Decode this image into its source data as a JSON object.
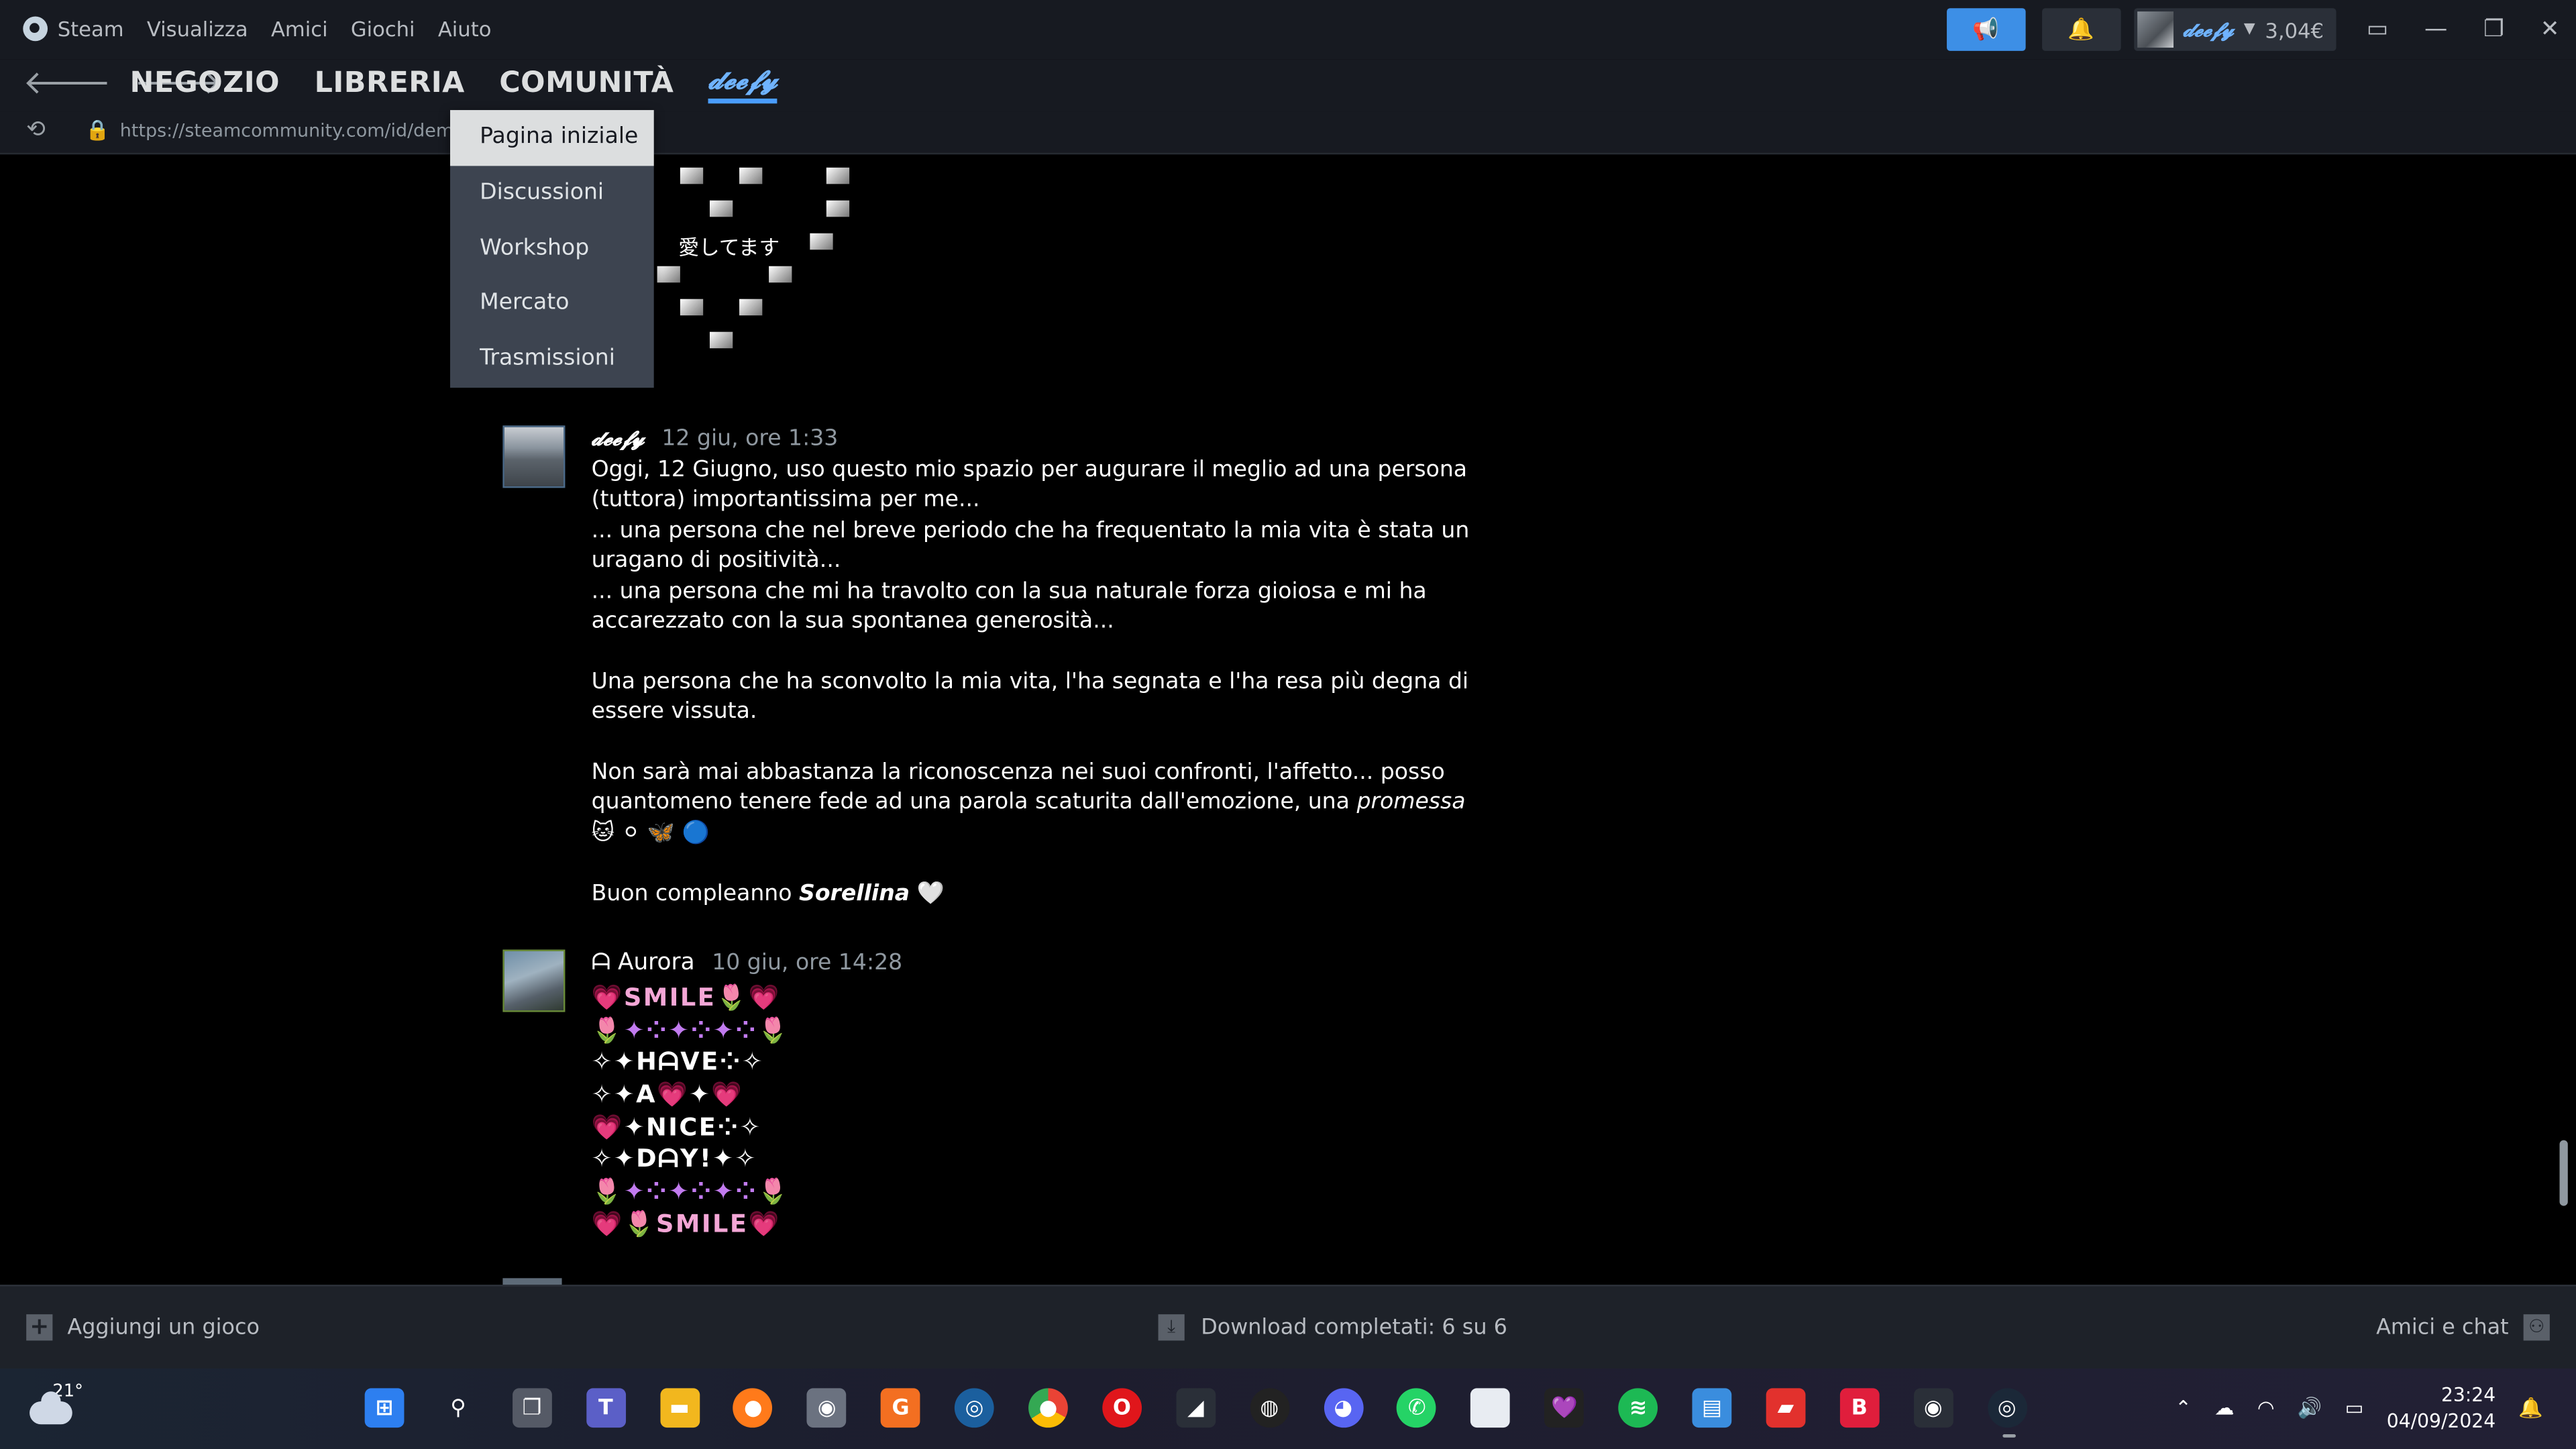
{
  "menubar": {
    "items": [
      "Steam",
      "Visualizza",
      "Amici",
      "Giochi",
      "Aiuto"
    ]
  },
  "account": {
    "nickname": "𝓭𝓮𝓮𝓯𝔂",
    "wallet": "3,04€"
  },
  "nav": {
    "links": [
      "NEGOZIO",
      "LIBRERIA",
      "COMUNITÀ"
    ],
    "user_tab": "𝓭𝓮𝓮𝓯𝔂"
  },
  "urlbar": {
    "url": "https://steamcommunity.com/id/demac"
  },
  "dropdown": {
    "items": [
      "Pagina iniziale",
      "Discussioni",
      "Workshop",
      "Mercato",
      "Trasmissioni"
    ]
  },
  "emoji_art": {
    "text": "愛してます"
  },
  "comments": [
    {
      "author": "𝓭𝓮𝓮𝓯𝔂",
      "time": "12 giu, ore 1:33",
      "lines": [
        "Oggi, 12 Giugno, uso questo mio spazio per augurare il meglio ad una persona (tuttora) importantissima per me...",
        "... una persona che nel breve periodo che ha frequentato la mia vita è stata un uragano di positività...",
        "... una persona che mi ha travolto con la sua naturale forza gioiosa e mi ha accarezzato con la sua spontanea generosità...",
        "",
        "Una persona che ha sconvolto la mia vita, l'ha segnata e l'ha resa più degna di essere vissuta.",
        "",
        "Non sarà mai abbastanza la riconoscenza nei suoi confronti, l'affetto... posso quantomeno tenere fede ad una parola scaturita dall'emozione, una",
        "",
        "Buon compleanno"
      ],
      "emphasis_word": "promessa",
      "emphasis_emoji": "🐱 ⚪ 🦋 🔵",
      "birthday_name": "Sorellina",
      "birthday_emoji": "🤍"
    },
    {
      "author": "ᗩ Aurora",
      "time": "10 giu, ore 14:28"
    }
  ],
  "smile_art": {
    "rows": [
      "💗SMILE🌷💗",
      "🌷✦⁘✦⁘✦⁘🌷",
      "✧✦HᗩVE⁘✧",
      "✧✦A💗✦💗",
      "💗✦NICE⁘✧",
      "✧✦DᗩY!✦✧",
      "🌷✦⁘✦⁘✦⁘🌷",
      "💗🌷SMILE💗"
    ]
  },
  "bottombar": {
    "add_game": "Aggiungi un gioco",
    "downloads": "Download completati: 6 su 6",
    "friends": "Amici e chat"
  },
  "taskbar": {
    "temperature": "21°",
    "time": "23:24",
    "date": "04/09/2024"
  },
  "colors": {
    "accent": "#3d8fe6",
    "chrome": "#171a21",
    "dropdown": "#3d4450",
    "link_blue": "#6fb3ff"
  }
}
